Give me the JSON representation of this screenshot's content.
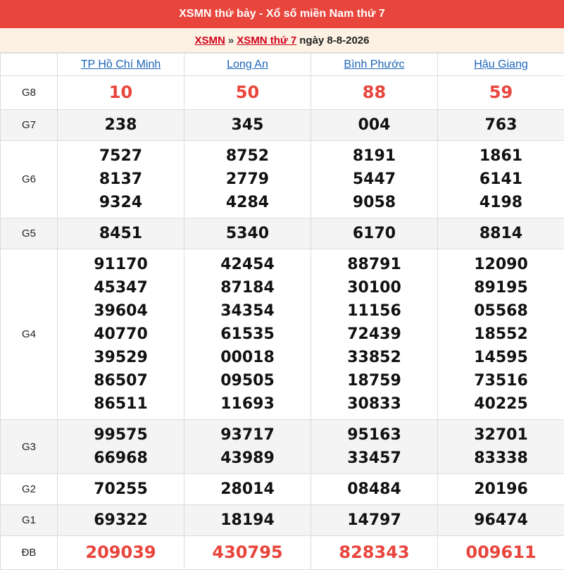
{
  "header": {
    "title": "XSMN thứ bảy - Xổ số miền Nam thứ 7"
  },
  "breadcrumb": {
    "link1": "XSMN",
    "sep": "»",
    "link2": "XSMN thứ 7",
    "date": "ngày 8-8-2026"
  },
  "provinces": [
    "TP Hồ Chí Minh",
    "Long An",
    "Bình Phước",
    "Hậu Giang"
  ],
  "prizes": [
    {
      "label": "G8",
      "values": [
        [
          "10"
        ],
        [
          "50"
        ],
        [
          "88"
        ],
        [
          "59"
        ]
      ]
    },
    {
      "label": "G7",
      "values": [
        [
          "238"
        ],
        [
          "345"
        ],
        [
          "004"
        ],
        [
          "763"
        ]
      ]
    },
    {
      "label": "G6",
      "values": [
        [
          "7527",
          "8137",
          "9324"
        ],
        [
          "8752",
          "2779",
          "4284"
        ],
        [
          "8191",
          "5447",
          "9058"
        ],
        [
          "1861",
          "6141",
          "4198"
        ]
      ]
    },
    {
      "label": "G5",
      "values": [
        [
          "8451"
        ],
        [
          "5340"
        ],
        [
          "6170"
        ],
        [
          "8814"
        ]
      ]
    },
    {
      "label": "G4",
      "values": [
        [
          "91170",
          "45347",
          "39604",
          "40770",
          "39529",
          "86507",
          "86511"
        ],
        [
          "42454",
          "87184",
          "34354",
          "61535",
          "00018",
          "09505",
          "11693"
        ],
        [
          "88791",
          "30100",
          "11156",
          "72439",
          "33852",
          "18759",
          "30833"
        ],
        [
          "12090",
          "89195",
          "05568",
          "18552",
          "14595",
          "73516",
          "40225"
        ]
      ]
    },
    {
      "label": "G3",
      "values": [
        [
          "99575",
          "66968"
        ],
        [
          "93717",
          "43989"
        ],
        [
          "95163",
          "33457"
        ],
        [
          "32701",
          "83338"
        ]
      ]
    },
    {
      "label": "G2",
      "values": [
        [
          "70255"
        ],
        [
          "28014"
        ],
        [
          "08484"
        ],
        [
          "20196"
        ]
      ]
    },
    {
      "label": "G1",
      "values": [
        [
          "69322"
        ],
        [
          "18194"
        ],
        [
          "14797"
        ],
        [
          "96474"
        ]
      ]
    },
    {
      "label": "ĐB",
      "values": [
        [
          "209039"
        ],
        [
          "430795"
        ],
        [
          "828343"
        ],
        [
          "009611"
        ]
      ]
    }
  ],
  "colors": {
    "header_bg": "#e8453c",
    "highlight_number": "#e8453c",
    "link": "#1a64b8",
    "breadcrumb_link": "#d0021b"
  }
}
